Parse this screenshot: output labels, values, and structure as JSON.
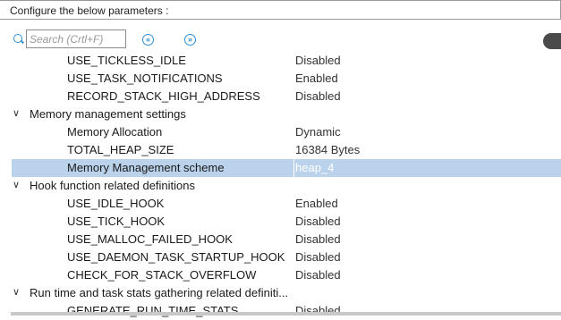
{
  "header": {
    "title": "Configure the below parameters :"
  },
  "search": {
    "placeholder": "Search (Crtl+F)"
  },
  "nav": {
    "prev_icon": "«",
    "next_icon": "»"
  },
  "colors": {
    "accent": "#2d8dd6",
    "selection": "#bad2ea"
  },
  "tree": {
    "rows": [
      {
        "type": "leaf",
        "label": "USE_TICKLESS_IDLE",
        "value": "Disabled"
      },
      {
        "type": "leaf",
        "label": "USE_TASK_NOTIFICATIONS",
        "value": "Enabled"
      },
      {
        "type": "leaf",
        "label": "RECORD_STACK_HIGH_ADDRESS",
        "value": "Disabled"
      },
      {
        "type": "group",
        "label": "Memory management settings",
        "expanded": true
      },
      {
        "type": "leaf",
        "label": "Memory Allocation",
        "value": "Dynamic"
      },
      {
        "type": "leaf",
        "label": "TOTAL_HEAP_SIZE",
        "value": "16384 Bytes"
      },
      {
        "type": "leaf",
        "label": "Memory Management scheme",
        "value": "heap_4",
        "selected": true
      },
      {
        "type": "group",
        "label": "Hook function related definitions",
        "expanded": true
      },
      {
        "type": "leaf",
        "label": "USE_IDLE_HOOK",
        "value": "Enabled"
      },
      {
        "type": "leaf",
        "label": "USE_TICK_HOOK",
        "value": "Disabled"
      },
      {
        "type": "leaf",
        "label": "USE_MALLOC_FAILED_HOOK",
        "value": "Disabled"
      },
      {
        "type": "leaf",
        "label": "USE_DAEMON_TASK_STARTUP_HOOK",
        "value": "Disabled"
      },
      {
        "type": "leaf",
        "label": "CHECK_FOR_STACK_OVERFLOW",
        "value": "Disabled"
      },
      {
        "type": "group",
        "label": "Run time and task stats gathering related definiti...",
        "expanded": true
      },
      {
        "type": "leaf",
        "label": "GENERATE_RUN_TIME_STATS",
        "value": "Disabled"
      }
    ]
  }
}
